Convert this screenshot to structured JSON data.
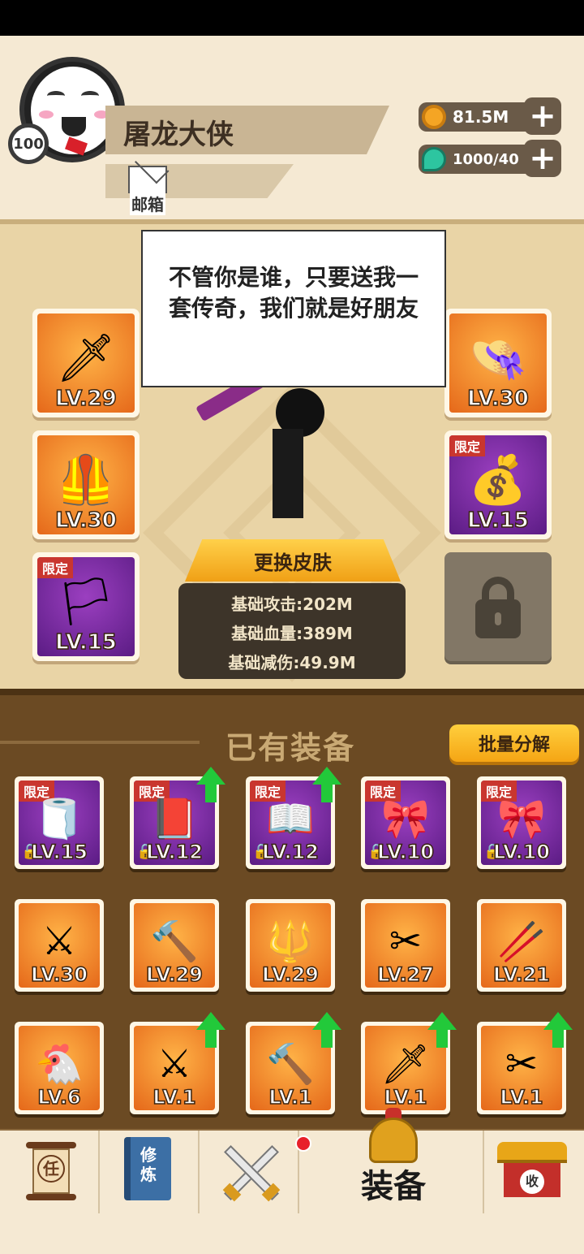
{
  "player": {
    "name": "屠龙大侠",
    "level": "100",
    "mail_label": "邮箱"
  },
  "resources": {
    "gold": "81.5M",
    "gems": "1000/40"
  },
  "character": {
    "speech": "不管你是谁，只要送我一套传奇，我们就是好朋友",
    "skin_button": "更换皮肤",
    "stats": [
      "基础攻击:202M",
      "基础血量:389M",
      "基础减伤:49.9M"
    ],
    "left_slots": [
      {
        "level": "LV.29",
        "icon": "sword-icon",
        "limited": ""
      },
      {
        "level": "LV.30",
        "icon": "armor-icon",
        "limited": ""
      },
      {
        "level": "LV.15",
        "icon": "banner-icon",
        "limited": "限定"
      }
    ],
    "right_slots": [
      {
        "level": "LV.30",
        "icon": "straw-hat-icon",
        "limited": ""
      },
      {
        "level": "LV.15",
        "icon": "gold-ingot-icon",
        "limited": "限定"
      }
    ]
  },
  "equipment": {
    "title": "已有装备",
    "batch_button": "批量分解",
    "items": [
      {
        "level": "LV.15",
        "limited": "限定",
        "locked": true,
        "upgrade": false,
        "icon": "toilet-paper-icon"
      },
      {
        "level": "LV.12",
        "limited": "限定",
        "locked": true,
        "upgrade": true,
        "icon": "comic-book-icon"
      },
      {
        "level": "LV.12",
        "limited": "限定",
        "locked": true,
        "upgrade": true,
        "icon": "magazine-icon"
      },
      {
        "level": "LV.10",
        "limited": "限定",
        "locked": true,
        "upgrade": false,
        "icon": "chinese-knot-icon"
      },
      {
        "level": "LV.10",
        "limited": "限定",
        "locked": true,
        "upgrade": false,
        "icon": "chinese-knot-icon"
      },
      {
        "level": "LV.30",
        "limited": "",
        "locked": false,
        "upgrade": false,
        "icon": "golden-sword-icon"
      },
      {
        "level": "LV.29",
        "limited": "",
        "locked": false,
        "upgrade": false,
        "icon": "mace-icon"
      },
      {
        "level": "LV.29",
        "limited": "",
        "locked": false,
        "upgrade": false,
        "icon": "spear-icon"
      },
      {
        "level": "LV.27",
        "limited": "",
        "locked": false,
        "upgrade": false,
        "icon": "scissors-icon"
      },
      {
        "level": "LV.21",
        "limited": "",
        "locked": false,
        "upgrade": false,
        "icon": "staff-icon"
      },
      {
        "level": "LV.6",
        "limited": "",
        "locked": false,
        "upgrade": false,
        "icon": "rubber-chicken-icon"
      },
      {
        "level": "LV.1",
        "limited": "",
        "locked": false,
        "upgrade": true,
        "icon": "golden-sword-icon"
      },
      {
        "level": "LV.1",
        "limited": "",
        "locked": false,
        "upgrade": true,
        "icon": "mace-icon"
      },
      {
        "level": "LV.1",
        "limited": "",
        "locked": false,
        "upgrade": true,
        "icon": "sword-icon"
      },
      {
        "level": "LV.1",
        "limited": "",
        "locked": false,
        "upgrade": true,
        "icon": "scissors-icon"
      }
    ]
  },
  "nav": {
    "task_glyph": "任",
    "book_glyph": "修炼",
    "equip_label": "装备",
    "shop_glyph": "收"
  },
  "colors": {
    "orange_slot": "#e5681a",
    "purple_slot": "#5b1c84",
    "upgrade_arrow": "#22c93a",
    "limited_tag": "#c9362f"
  }
}
